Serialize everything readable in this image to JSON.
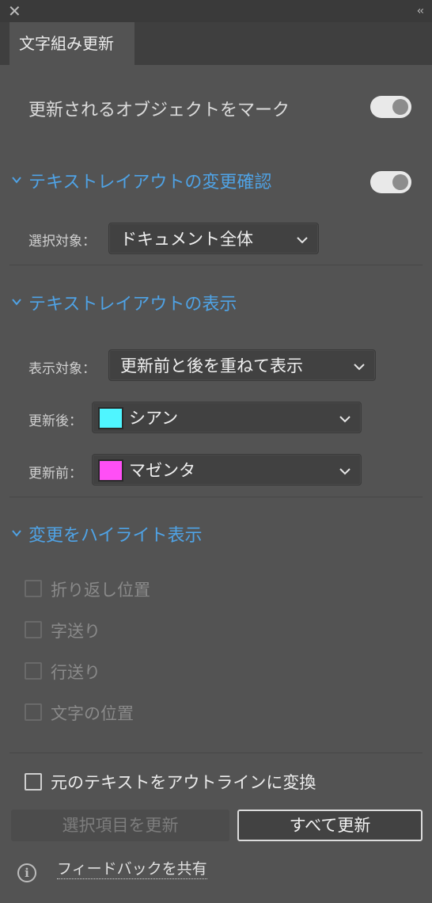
{
  "panel": {
    "tab_title": "文字組み更新",
    "close_glyph": "✕",
    "collapse_glyph": "‹‹"
  },
  "mark_updated": {
    "label": "更新されるオブジェクトをマーク",
    "toggle_on": true
  },
  "layout_check": {
    "title": "テキストレイアウトの変更確認",
    "toggle_on": true,
    "selection_label": "選択対象：",
    "selection_value": "ドキュメント全体"
  },
  "layout_display": {
    "title": "テキストレイアウトの表示",
    "display_label": "表示対象：",
    "display_value": "更新前と後を重ねて表示",
    "after_label": "更新後：",
    "after_value": "シアン",
    "after_color": "#4ff5ff",
    "before_label": "更新前：",
    "before_value": "マゼンタ",
    "before_color": "#ff4ff5"
  },
  "highlight": {
    "title": "変更をハイライト表示",
    "options": [
      {
        "label": "折り返し位置",
        "checked": false,
        "enabled": false
      },
      {
        "label": "字送り",
        "checked": false,
        "enabled": false
      },
      {
        "label": "行送り",
        "checked": false,
        "enabled": false
      },
      {
        "label": "文字の位置",
        "checked": false,
        "enabled": false
      }
    ]
  },
  "outline": {
    "label": "元のテキストをアウトラインに変換",
    "checked": false
  },
  "buttons": {
    "update_selected": "選択項目を更新",
    "update_all": "すべて更新"
  },
  "feedback": {
    "link_text": "フィードバックを共有",
    "icon": "info-icon"
  }
}
